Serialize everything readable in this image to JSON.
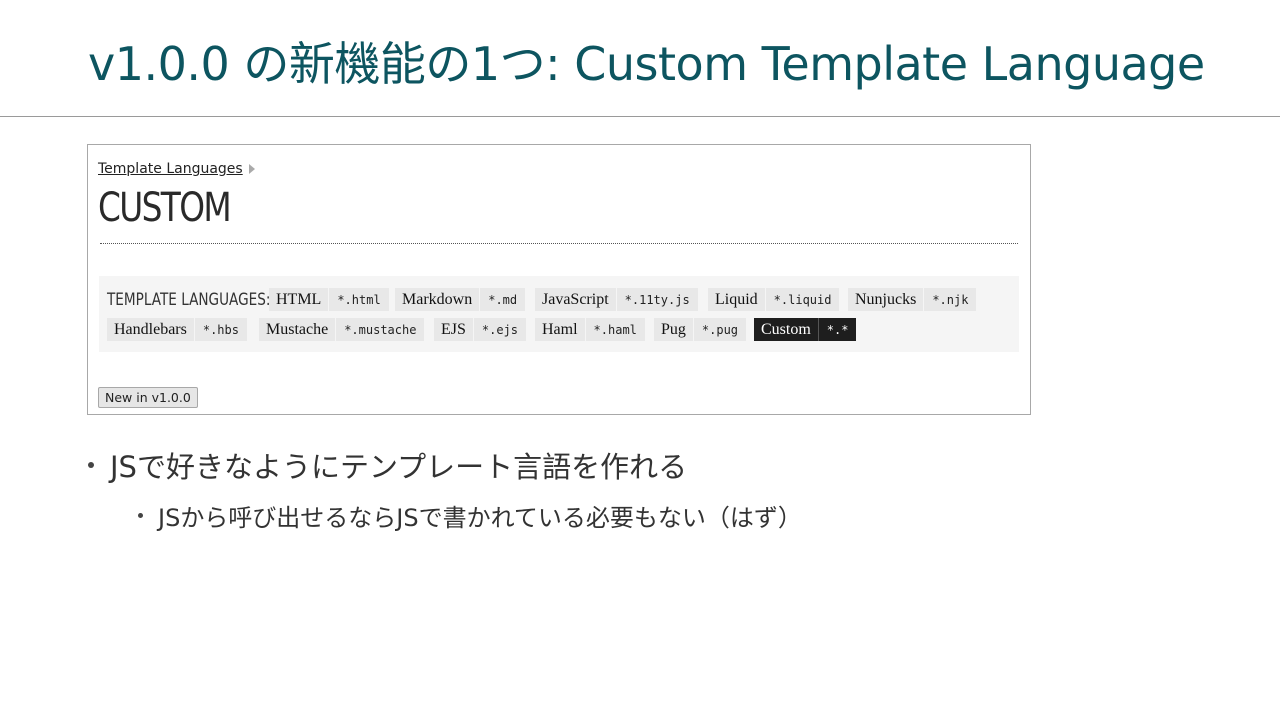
{
  "slide": {
    "title": "v1.0.0 の新機能の1つ: Custom Template Language"
  },
  "screenshot": {
    "breadcrumb": "Template Languages",
    "heading": "CUSTOM",
    "languages_label": "TEMPLATE LANGUAGES:",
    "languages": [
      {
        "name": "HTML",
        "ext": "*.html"
      },
      {
        "name": "Markdown",
        "ext": "*.md"
      },
      {
        "name": "JavaScript",
        "ext": "*.11ty.js"
      },
      {
        "name": "Liquid",
        "ext": "*.liquid"
      },
      {
        "name": "Nunjucks",
        "ext": "*.njk"
      },
      {
        "name": "Handlebars",
        "ext": "*.hbs"
      },
      {
        "name": "Mustache",
        "ext": "*.mustache"
      },
      {
        "name": "EJS",
        "ext": "*.ejs"
      },
      {
        "name": "Haml",
        "ext": "*.haml"
      },
      {
        "name": "Pug",
        "ext": "*.pug"
      },
      {
        "name": "Custom",
        "ext": "*.*"
      }
    ],
    "active_language": "Custom",
    "badge": "New in v1.0.0"
  },
  "bullets": {
    "level1": "JSで好きなようにテンプレート言語を作れる",
    "level2": "JSから呼び出せるならJSで書かれている必要もない（はず）"
  }
}
